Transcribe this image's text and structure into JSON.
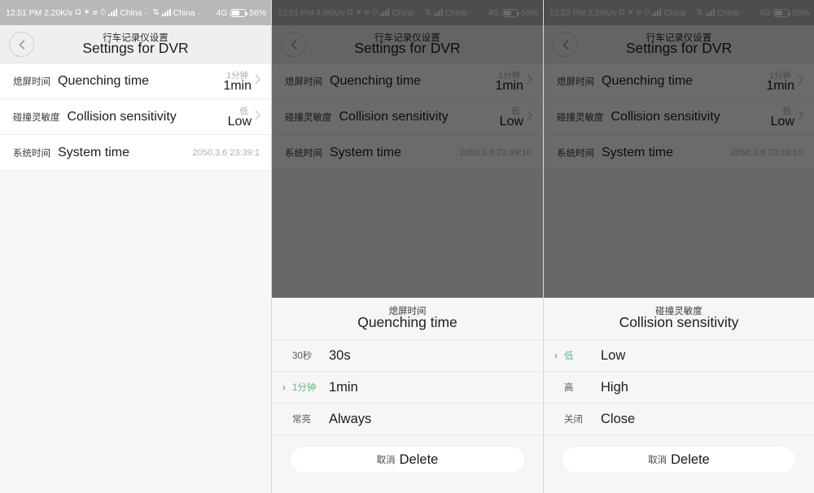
{
  "accent_color": "#5cb87a",
  "panels": [
    {
      "status_bar": {
        "time": "12:51 PM",
        "net_speed": "2.20K/s",
        "icons": [
          "headphone-icon",
          "bluetooth-icon",
          "mute-icon",
          "alarm-icon"
        ],
        "carrier_1": "China",
        "carrier_1_dots": "··",
        "carrier_2": "China",
        "carrier_2_dots": "··",
        "network_type": "4G",
        "battery": "56%"
      },
      "title_cn": "行车记录仪设置",
      "title_en": "Settings for DVR",
      "rows": [
        {
          "label_cn": "熄屏时间",
          "label_en": "Quenching time",
          "value_cn": "1分钟",
          "value_en": "1min",
          "type": "chevron"
        },
        {
          "label_cn": "碰撞灵敏度",
          "label_en": "Collision sensitivity",
          "value_cn": "低",
          "value_en": "Low",
          "type": "chevron"
        },
        {
          "label_cn": "系统时间",
          "label_en": "System time",
          "value_text": "2050.3.6 23:39:1",
          "type": "text"
        }
      ],
      "sheet": null
    },
    {
      "status_bar": {
        "time": "12:51 PM",
        "net_speed": "4.06K/s",
        "icons": [
          "headphone-icon",
          "bluetooth-icon",
          "mute-icon",
          "alarm-icon"
        ],
        "carrier_1": "China",
        "carrier_1_dots": "··",
        "carrier_2": "China",
        "carrier_2_dots": "··",
        "network_type": "4G",
        "battery": "56%"
      },
      "title_cn": "行车记录仪设置",
      "title_en": "Settings for DVR",
      "rows": [
        {
          "label_cn": "熄屏时间",
          "label_en": "Quenching time",
          "value_cn": "1分钟",
          "value_en": "1min",
          "type": "chevron"
        },
        {
          "label_cn": "碰撞灵敏度",
          "label_en": "Collision sensitivity",
          "value_cn": "低",
          "value_en": "Low",
          "type": "chevron"
        },
        {
          "label_cn": "系统时间",
          "label_en": "System time",
          "value_text": "2050.3.6 23:39:10",
          "type": "text"
        }
      ],
      "sheet": {
        "title_cn": "熄屏时间",
        "title_en": "Quenching time",
        "options": [
          {
            "cn": "30秒",
            "en": "30s",
            "selected": false
          },
          {
            "cn": "1分钟",
            "en": "1min",
            "selected": true
          },
          {
            "cn": "常亮",
            "en": "Always",
            "selected": false
          }
        ],
        "button_cn": "取消",
        "button_en": "Delete"
      }
    },
    {
      "status_bar": {
        "time": "12:52 PM",
        "net_speed": "2.58K/s",
        "icons": [
          "headphone-icon",
          "bluetooth-icon",
          "mute-icon",
          "alarm-icon"
        ],
        "carrier_1": "China",
        "carrier_1_dots": "··",
        "carrier_2": "China",
        "carrier_2_dots": "··",
        "network_type": "4G",
        "battery": "56%"
      },
      "title_cn": "行车记录仪设置",
      "title_en": "Settings for DVR",
      "rows": [
        {
          "label_cn": "熄屏时间",
          "label_en": "Quenching time",
          "value_cn": "1分钟",
          "value_en": "1min",
          "type": "chevron"
        },
        {
          "label_cn": "碰撞灵敏度",
          "label_en": "Collision sensitivity",
          "value_cn": "低",
          "value_en": "Low",
          "type": "chevron"
        },
        {
          "label_cn": "系统时间",
          "label_en": "System time",
          "value_text": "2050.3.6 23:39:10",
          "type": "text"
        }
      ],
      "sheet": {
        "title_cn": "碰撞灵敏度",
        "title_en": "Collision sensitivity",
        "options": [
          {
            "cn": "低",
            "en": "Low",
            "selected": true
          },
          {
            "cn": "高",
            "en": "High",
            "selected": false
          },
          {
            "cn": "关闭",
            "en": "Close",
            "selected": false
          }
        ],
        "button_cn": "取消",
        "button_en": "Delete"
      }
    }
  ]
}
